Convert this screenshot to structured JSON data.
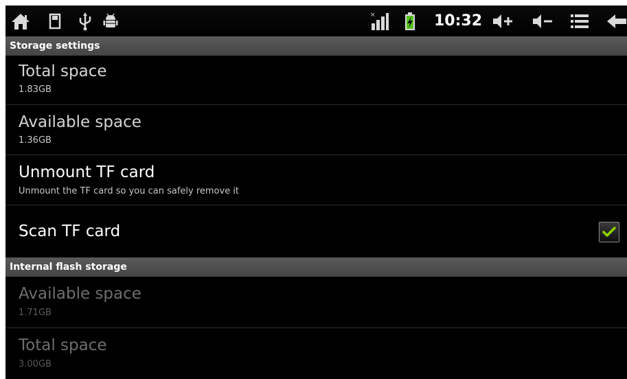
{
  "statusbar": {
    "left_icons": [
      "home-icon",
      "sd-card-icon",
      "usb-icon",
      "android-debug-icon"
    ],
    "right_icons": [
      "signal-no-service-icon",
      "battery-charging-icon",
      "volume-up-icon",
      "volume-down-icon",
      "menu-icon",
      "back-icon"
    ],
    "time": "10:32"
  },
  "sections": {
    "storage": {
      "header": "Storage settings",
      "total": {
        "title": "Total space",
        "summary": "1.83GB"
      },
      "available": {
        "title": "Available space",
        "summary": "1.36GB"
      },
      "unmount": {
        "title": "Unmount TF card",
        "summary": "Unmount the TF card so you can safely remove it"
      },
      "scan": {
        "title": "Scan TF card",
        "checked": true
      }
    },
    "internal": {
      "header": "Internal flash storage",
      "available": {
        "title": "Available space",
        "summary": "1.71GB"
      },
      "total": {
        "title": "Total space",
        "summary": "3.00GB"
      }
    }
  },
  "colors": {
    "accent_check": "#8fd400",
    "section_header_bg": "#4f4f4f",
    "background": "#000000"
  }
}
